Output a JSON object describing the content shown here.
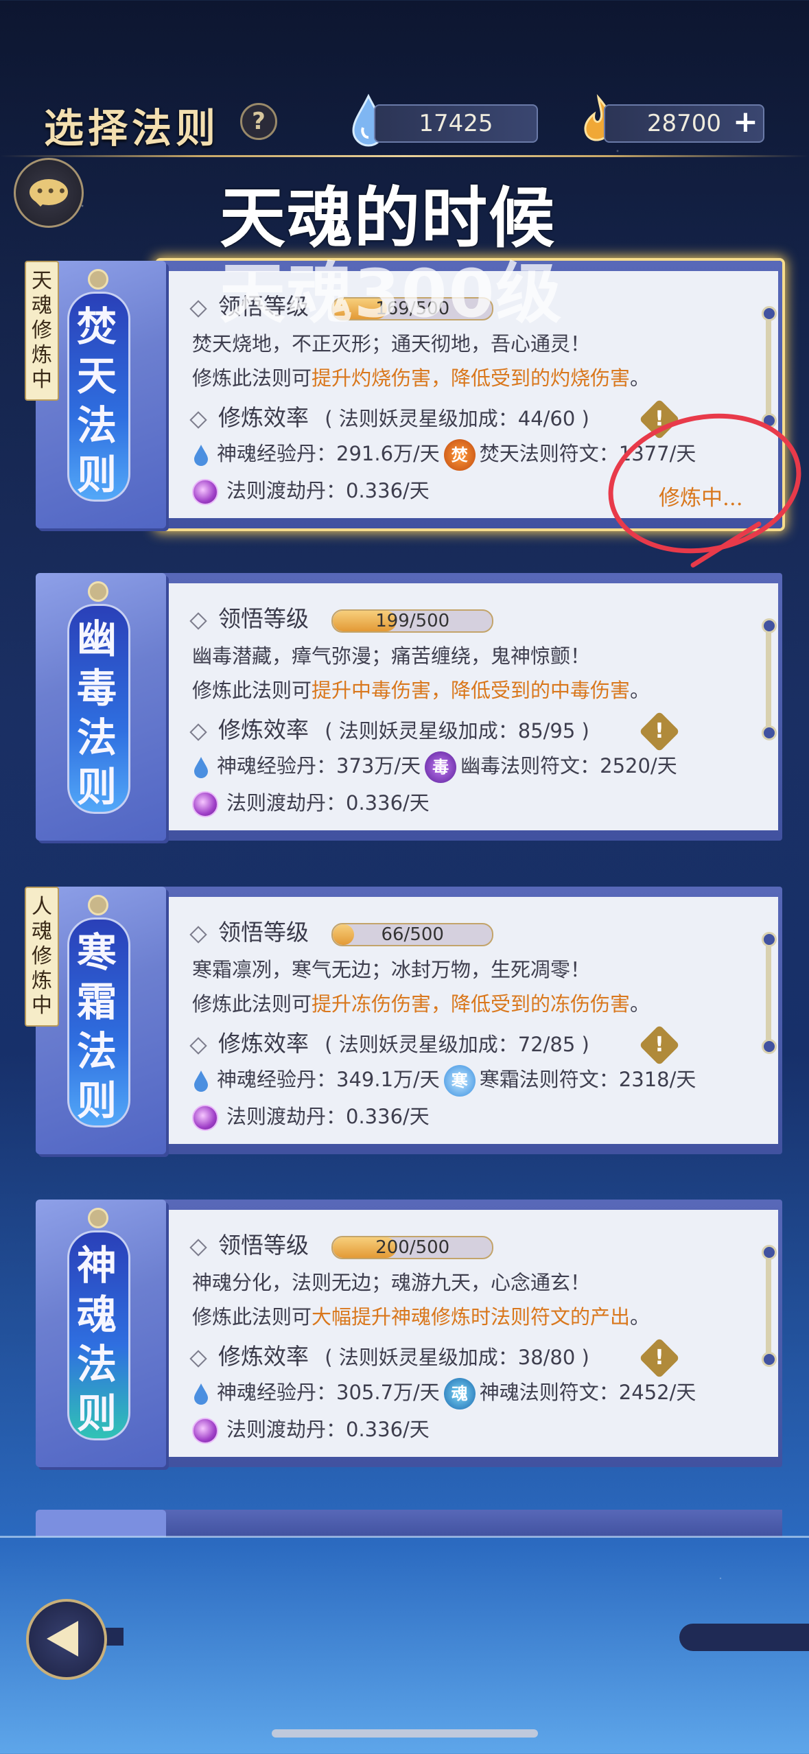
{
  "header": {
    "title": "选择法则",
    "help_label": "?",
    "resource1_value": "17425",
    "resource2_value": "28700",
    "plus_label": "+"
  },
  "overlay": {
    "line1": "天魂的时候",
    "line2": "天魂300级"
  },
  "cards": [
    {
      "scroll_name": "焚天法则",
      "ribbon": "天魂修炼中",
      "level_label": "领悟等级",
      "level_text": "169/500",
      "level_ratio": 0.338,
      "desc1": "焚天烧地，不正灭形；通天彻地，吾心通灵！",
      "desc2_prefix": "修炼此法则可",
      "desc2_highlight": "提升灼烧伤害，降低受到的灼烧伤害",
      "desc2_suffix": "。",
      "efficiency": "修炼效率",
      "bonus": "( 法则妖灵星级加成：44/60 )",
      "exp": "神魂经验丹：291.6万/天",
      "rune_glyph": "焚",
      "rune_text": "焚天法则符文：1377/天",
      "pill": "法则渡劫丹：0.336/天",
      "status": "修炼中..."
    },
    {
      "scroll_name": "幽毒法则",
      "ribbon": "",
      "level_label": "领悟等级",
      "level_text": "199/500",
      "level_ratio": 0.398,
      "desc1": "幽毒潜藏，瘴气弥漫；痛苦缠绕，鬼神惊颤！",
      "desc2_prefix": "修炼此法则可",
      "desc2_highlight": "提升中毒伤害，降低受到的中毒伤害",
      "desc2_suffix": "。",
      "efficiency": "修炼效率",
      "bonus": "( 法则妖灵星级加成：85/95 )",
      "exp": "神魂经验丹：373万/天",
      "rune_glyph": "毒",
      "rune_text": "幽毒法则符文：2520/天",
      "pill": "法则渡劫丹：0.336/天",
      "status": ""
    },
    {
      "scroll_name": "寒霜法则",
      "ribbon": "人魂修炼中",
      "level_label": "领悟等级",
      "level_text": "66/500",
      "level_ratio": 0.132,
      "desc1": "寒霜凛冽，寒气无边；冰封万物，生死凋零！",
      "desc2_prefix": "修炼此法则可",
      "desc2_highlight": "提升冻伤伤害，降低受到的冻伤伤害",
      "desc2_suffix": "。",
      "efficiency": "修炼效率",
      "bonus": "( 法则妖灵星级加成：72/85 )",
      "exp": "神魂经验丹：349.1万/天",
      "rune_glyph": "寒",
      "rune_text": "寒霜法则符文：2318/天",
      "pill": "法则渡劫丹：0.336/天",
      "status": ""
    },
    {
      "scroll_name": "神魂法则",
      "ribbon": "",
      "level_label": "领悟等级",
      "level_text": "200/500",
      "level_ratio": 0.4,
      "desc1": "神魂分化，法则无边；魂游九天，心念通玄！",
      "desc2_prefix": "修炼此法则可",
      "desc2_highlight": "大幅提升神魂修炼时法则符文的产出",
      "desc2_suffix": "。",
      "efficiency": "修炼效率",
      "bonus": "( 法则妖灵星级加成：38/80 )",
      "exp": "神魂经验丹：305.7万/天",
      "rune_glyph": "魂",
      "rune_text": "神魂法则符文：2452/天",
      "pill": "法则渡劫丹：0.336/天",
      "status": ""
    }
  ],
  "colors": {
    "highlight": "#d9771c",
    "active_glow": "#f1c75a",
    "annotation": "#e83a4a"
  }
}
